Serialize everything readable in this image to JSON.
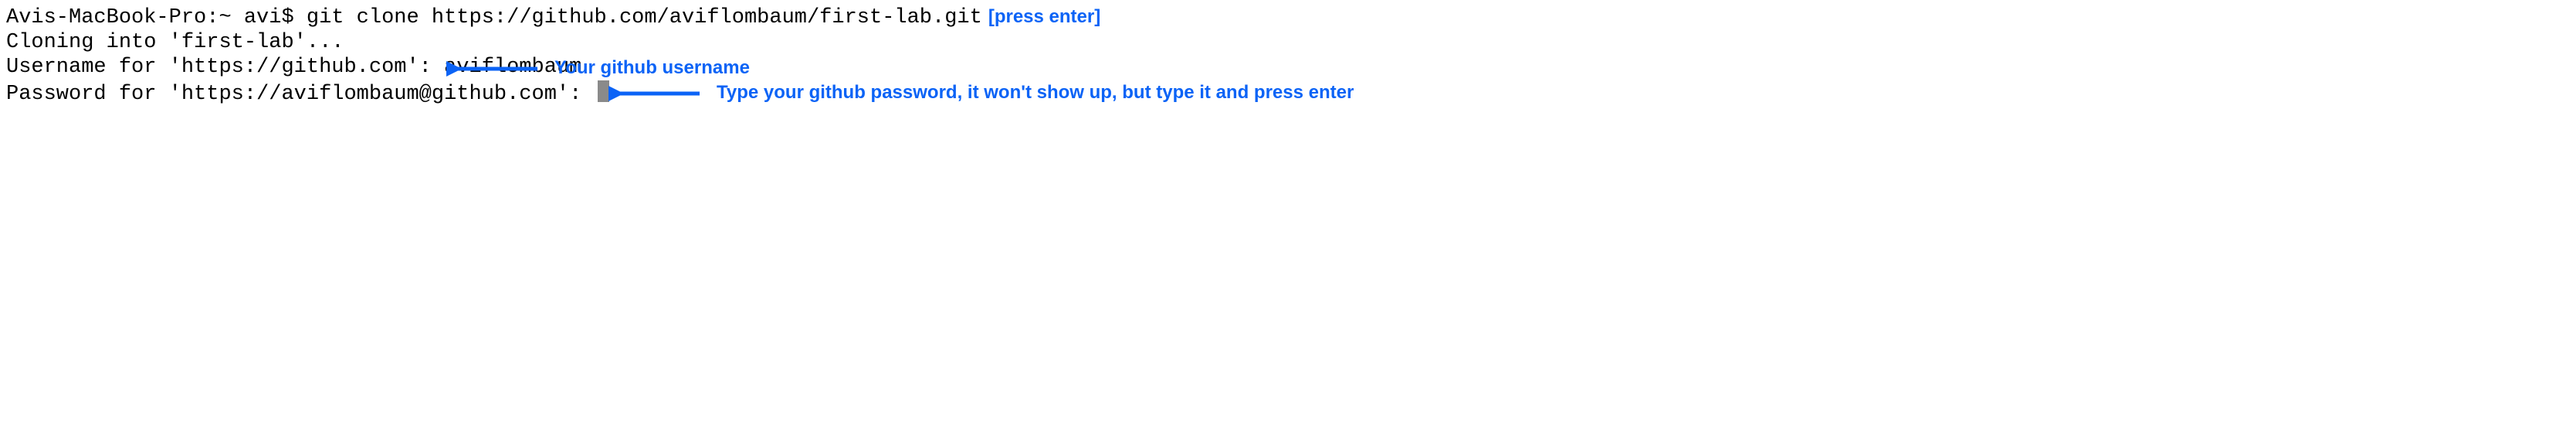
{
  "terminal": {
    "line1_prompt": "Avis-MacBook-Pro:~ avi$ ",
    "line1_command": "git clone https://github.com/aviflombaum/first-lab.git",
    "line2": "Cloning into 'first-lab'...",
    "line3_prompt": "Username for 'https://github.com': ",
    "line3_value": "aviflombaum",
    "line4_prompt": "Password for 'https://aviflombaum@github.com': "
  },
  "annotations": {
    "press_enter": "[press enter]",
    "username_hint": "Your github username",
    "password_hint": "Type your github password, it won't show up, but type it and press enter"
  },
  "colors": {
    "annotation_blue": "#0b63f6",
    "cursor_gray": "#8a8a8a"
  }
}
